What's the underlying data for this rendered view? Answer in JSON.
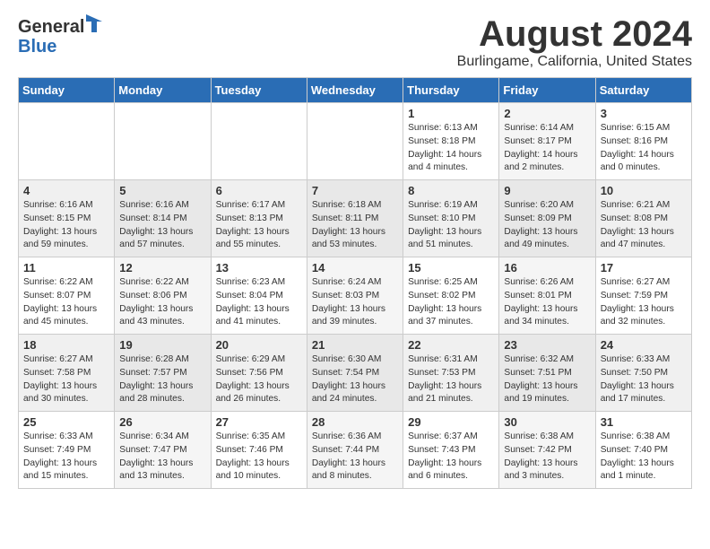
{
  "header": {
    "logo_general": "General",
    "logo_blue": "Blue",
    "month_title": "August 2024",
    "location": "Burlingame, California, United States"
  },
  "calendar": {
    "days_of_week": [
      "Sunday",
      "Monday",
      "Tuesday",
      "Wednesday",
      "Thursday",
      "Friday",
      "Saturday"
    ],
    "weeks": [
      [
        {
          "day": "",
          "info": ""
        },
        {
          "day": "",
          "info": ""
        },
        {
          "day": "",
          "info": ""
        },
        {
          "day": "",
          "info": ""
        },
        {
          "day": "1",
          "info": "Sunrise: 6:13 AM\nSunset: 8:18 PM\nDaylight: 14 hours\nand 4 minutes."
        },
        {
          "day": "2",
          "info": "Sunrise: 6:14 AM\nSunset: 8:17 PM\nDaylight: 14 hours\nand 2 minutes."
        },
        {
          "day": "3",
          "info": "Sunrise: 6:15 AM\nSunset: 8:16 PM\nDaylight: 14 hours\nand 0 minutes."
        }
      ],
      [
        {
          "day": "4",
          "info": "Sunrise: 6:16 AM\nSunset: 8:15 PM\nDaylight: 13 hours\nand 59 minutes."
        },
        {
          "day": "5",
          "info": "Sunrise: 6:16 AM\nSunset: 8:14 PM\nDaylight: 13 hours\nand 57 minutes."
        },
        {
          "day": "6",
          "info": "Sunrise: 6:17 AM\nSunset: 8:13 PM\nDaylight: 13 hours\nand 55 minutes."
        },
        {
          "day": "7",
          "info": "Sunrise: 6:18 AM\nSunset: 8:11 PM\nDaylight: 13 hours\nand 53 minutes."
        },
        {
          "day": "8",
          "info": "Sunrise: 6:19 AM\nSunset: 8:10 PM\nDaylight: 13 hours\nand 51 minutes."
        },
        {
          "day": "9",
          "info": "Sunrise: 6:20 AM\nSunset: 8:09 PM\nDaylight: 13 hours\nand 49 minutes."
        },
        {
          "day": "10",
          "info": "Sunrise: 6:21 AM\nSunset: 8:08 PM\nDaylight: 13 hours\nand 47 minutes."
        }
      ],
      [
        {
          "day": "11",
          "info": "Sunrise: 6:22 AM\nSunset: 8:07 PM\nDaylight: 13 hours\nand 45 minutes."
        },
        {
          "day": "12",
          "info": "Sunrise: 6:22 AM\nSunset: 8:06 PM\nDaylight: 13 hours\nand 43 minutes."
        },
        {
          "day": "13",
          "info": "Sunrise: 6:23 AM\nSunset: 8:04 PM\nDaylight: 13 hours\nand 41 minutes."
        },
        {
          "day": "14",
          "info": "Sunrise: 6:24 AM\nSunset: 8:03 PM\nDaylight: 13 hours\nand 39 minutes."
        },
        {
          "day": "15",
          "info": "Sunrise: 6:25 AM\nSunset: 8:02 PM\nDaylight: 13 hours\nand 37 minutes."
        },
        {
          "day": "16",
          "info": "Sunrise: 6:26 AM\nSunset: 8:01 PM\nDaylight: 13 hours\nand 34 minutes."
        },
        {
          "day": "17",
          "info": "Sunrise: 6:27 AM\nSunset: 7:59 PM\nDaylight: 13 hours\nand 32 minutes."
        }
      ],
      [
        {
          "day": "18",
          "info": "Sunrise: 6:27 AM\nSunset: 7:58 PM\nDaylight: 13 hours\nand 30 minutes."
        },
        {
          "day": "19",
          "info": "Sunrise: 6:28 AM\nSunset: 7:57 PM\nDaylight: 13 hours\nand 28 minutes."
        },
        {
          "day": "20",
          "info": "Sunrise: 6:29 AM\nSunset: 7:56 PM\nDaylight: 13 hours\nand 26 minutes."
        },
        {
          "day": "21",
          "info": "Sunrise: 6:30 AM\nSunset: 7:54 PM\nDaylight: 13 hours\nand 24 minutes."
        },
        {
          "day": "22",
          "info": "Sunrise: 6:31 AM\nSunset: 7:53 PM\nDaylight: 13 hours\nand 21 minutes."
        },
        {
          "day": "23",
          "info": "Sunrise: 6:32 AM\nSunset: 7:51 PM\nDaylight: 13 hours\nand 19 minutes."
        },
        {
          "day": "24",
          "info": "Sunrise: 6:33 AM\nSunset: 7:50 PM\nDaylight: 13 hours\nand 17 minutes."
        }
      ],
      [
        {
          "day": "25",
          "info": "Sunrise: 6:33 AM\nSunset: 7:49 PM\nDaylight: 13 hours\nand 15 minutes."
        },
        {
          "day": "26",
          "info": "Sunrise: 6:34 AM\nSunset: 7:47 PM\nDaylight: 13 hours\nand 13 minutes."
        },
        {
          "day": "27",
          "info": "Sunrise: 6:35 AM\nSunset: 7:46 PM\nDaylight: 13 hours\nand 10 minutes."
        },
        {
          "day": "28",
          "info": "Sunrise: 6:36 AM\nSunset: 7:44 PM\nDaylight: 13 hours\nand 8 minutes."
        },
        {
          "day": "29",
          "info": "Sunrise: 6:37 AM\nSunset: 7:43 PM\nDaylight: 13 hours\nand 6 minutes."
        },
        {
          "day": "30",
          "info": "Sunrise: 6:38 AM\nSunset: 7:42 PM\nDaylight: 13 hours\nand 3 minutes."
        },
        {
          "day": "31",
          "info": "Sunrise: 6:38 AM\nSunset: 7:40 PM\nDaylight: 13 hours\nand 1 minute."
        }
      ]
    ]
  }
}
